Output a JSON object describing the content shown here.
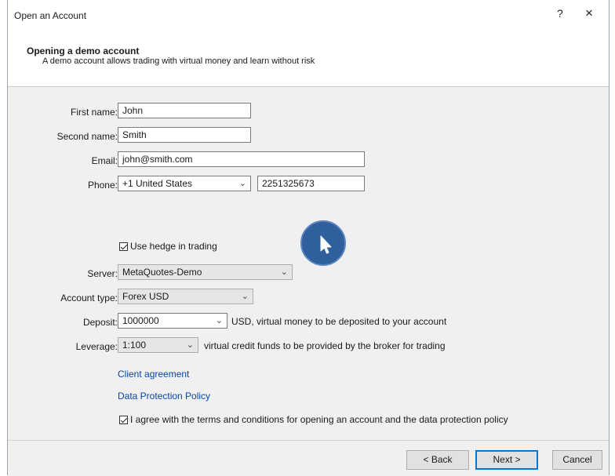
{
  "window": {
    "title": "Open an Account",
    "help_label": "?",
    "close_label": "×"
  },
  "header": {
    "title": "Opening a demo account",
    "subtitle": "A demo account allows trading with virtual money and learn without risk"
  },
  "form": {
    "first_name": {
      "label": "First name:",
      "value": "John"
    },
    "second_name": {
      "label": "Second name:",
      "value": "Smith"
    },
    "email": {
      "label": "Email:",
      "value": "john@smith.com"
    },
    "phone": {
      "label": "Phone:",
      "country": "+1 United States",
      "number": "2251325673"
    },
    "hedge": {
      "label": "Use hedge in trading",
      "checked": true
    },
    "server": {
      "label": "Server:",
      "value": "MetaQuotes-Demo"
    },
    "account_type": {
      "label": "Account type:",
      "value": "Forex USD"
    },
    "deposit": {
      "label": "Deposit:",
      "value": "1000000",
      "note": "USD, virtual money to be deposited to your account"
    },
    "leverage": {
      "label": "Leverage:",
      "value": "1:100",
      "note": "virtual credit funds to be provided by the broker for trading"
    }
  },
  "links": {
    "client_agreement": "Client agreement",
    "data_protection": "Data Protection Policy"
  },
  "agreement": {
    "label": "I agree with the terms and conditions for opening an account and the data protection policy",
    "checked": true
  },
  "buttons": {
    "back": "< Back",
    "next": "Next >",
    "cancel": "Cancel"
  },
  "icons": {
    "caret": "chevron-down-icon",
    "cursor": "mouse-pointer-icon"
  },
  "colors": {
    "link": "#0645ad",
    "accent": "#0078d7",
    "cursor_badge": "#2f5f9c"
  }
}
